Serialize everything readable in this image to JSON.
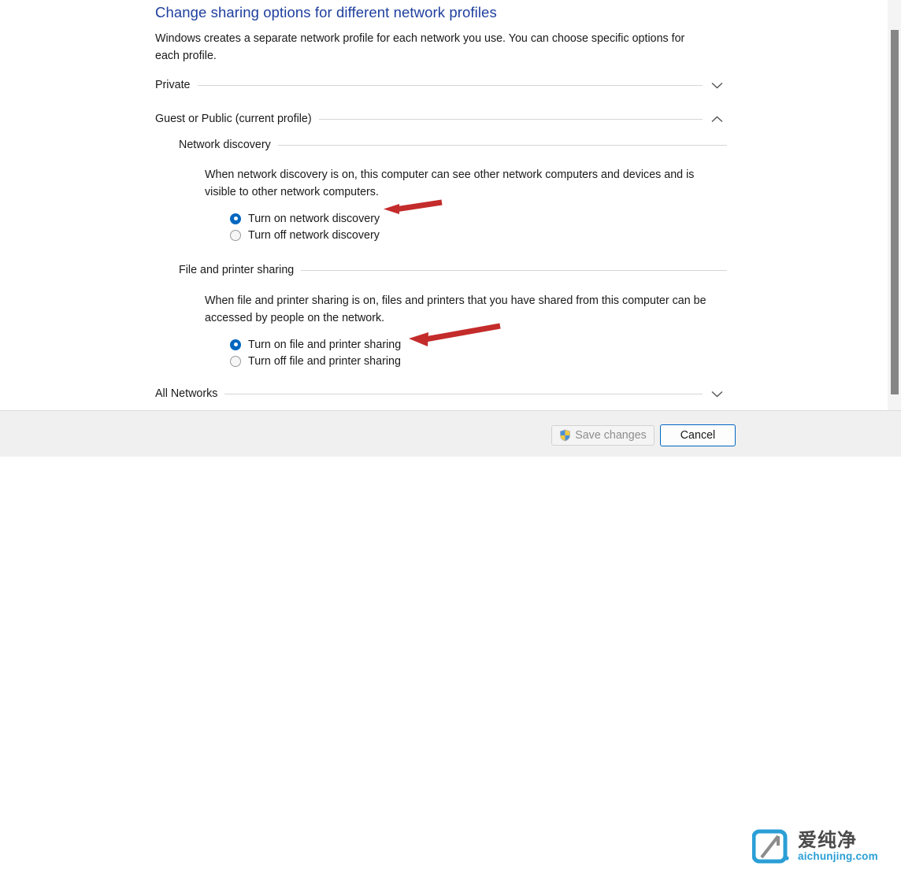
{
  "page": {
    "title": "Change sharing options for different network profiles",
    "intro": "Windows creates a separate network profile for each network you use. You can choose specific options for each profile.",
    "title_color": "#1e3f9e"
  },
  "profiles": [
    {
      "label": "Private",
      "state": "collapsed",
      "chevron": "chevron-down-icon"
    },
    {
      "label": "Guest or Public (current profile)",
      "state": "expanded",
      "chevron": "chevron-up-icon"
    },
    {
      "label": "All Networks",
      "state": "collapsed",
      "chevron": "chevron-down-icon"
    }
  ],
  "sections": [
    {
      "heading": "Network discovery",
      "description": "When network discovery is on, this computer can see other network computers and devices and is visible to other network computers.",
      "options": [
        {
          "label": "Turn on network discovery",
          "selected": true
        },
        {
          "label": "Turn off network discovery",
          "selected": false
        }
      ]
    },
    {
      "heading": "File and printer sharing",
      "description": "When file and printer sharing is on, files and printers that you have shared from this computer can be accessed by people on the network.",
      "options": [
        {
          "label": "Turn on file and printer sharing",
          "selected": true
        },
        {
          "label": "Turn off file and printer sharing",
          "selected": false
        }
      ]
    }
  ],
  "annotations": {
    "arrow_color": "#cc2222",
    "arrows": [
      {
        "name": "arrow-to-turn-on-network-discovery",
        "points_to": "Turn on network discovery"
      },
      {
        "name": "arrow-to-turn-on-file-and-printer-sharing",
        "points_to": "Turn on file and printer sharing"
      }
    ]
  },
  "buttons": {
    "save": {
      "label": "Save changes",
      "enabled": false,
      "icon": "uac-shield-icon"
    },
    "cancel": {
      "label": "Cancel",
      "enabled": true,
      "focused": true,
      "accent": "#0067c0"
    }
  },
  "watermark": {
    "cn": "爱纯净",
    "en": "aichunjing.com",
    "color": "#2a9fd6"
  },
  "scrollbar": {
    "orientation": "vertical",
    "position": "top"
  }
}
